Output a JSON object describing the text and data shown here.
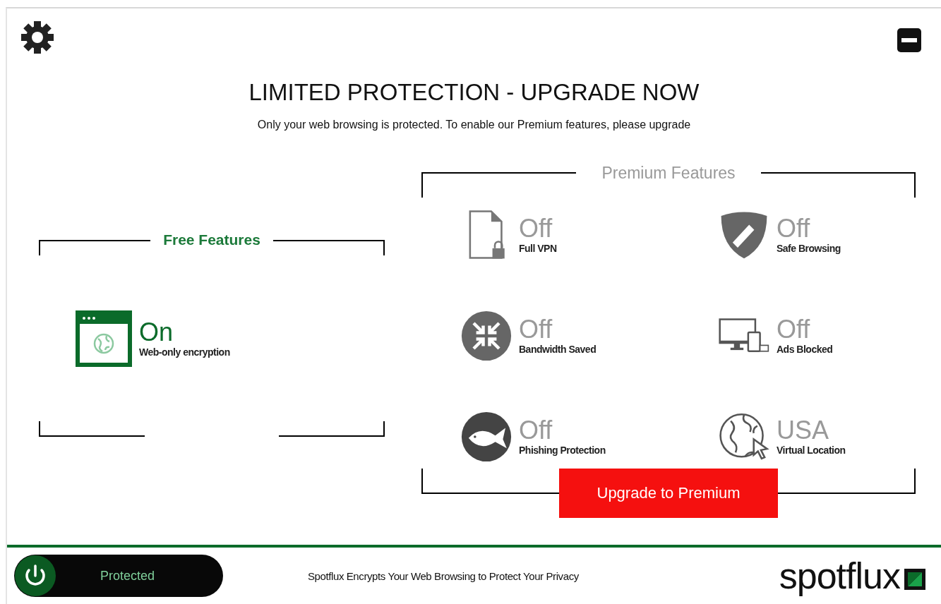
{
  "title": "LIMITED PROTECTION - UPGRADE NOW",
  "subtitle": "Only your web browsing is protected. To enable our Premium features, please upgrade",
  "free_features": {
    "heading": "Free Features",
    "items": [
      {
        "kind": "browser",
        "status": "On",
        "on": true,
        "label": "Web-only encryption"
      }
    ]
  },
  "premium_features": {
    "heading": "Premium Features",
    "items": [
      {
        "kind": "file-lock",
        "status": "Off",
        "on": false,
        "label": "Full VPN"
      },
      {
        "kind": "shield",
        "status": "Off",
        "on": false,
        "label": "Safe Browsing"
      },
      {
        "kind": "compress",
        "status": "Off",
        "on": false,
        "label": "Bandwidth Saved"
      },
      {
        "kind": "devices",
        "status": "Off",
        "on": false,
        "label": "Ads Blocked"
      },
      {
        "kind": "fish",
        "status": "Off",
        "on": false,
        "label": "Phishing Protection"
      },
      {
        "kind": "globe",
        "status": "USA",
        "on": false,
        "label": "Virtual Location"
      }
    ],
    "button": "Upgrade to Premium"
  },
  "footer": {
    "toggle": {
      "label": "Protected",
      "on": true
    },
    "message": "Spotflux Encrypts Your Web Browsing to Protect Your Privacy",
    "logo": "spotflux"
  }
}
